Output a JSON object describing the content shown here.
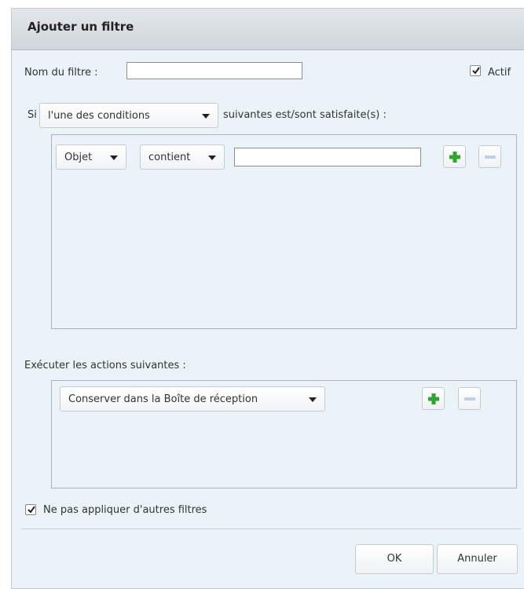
{
  "dialog": {
    "title": "Ajouter un filtre"
  },
  "filter_name": {
    "label": "Nom du filtre :",
    "value": ""
  },
  "active": {
    "label": "Actif",
    "checked": true
  },
  "conditions": {
    "prefix": "Si",
    "match_mode": "l'une des conditions",
    "suffix": "suivantes est/sont satisfaite(s) :",
    "rows": [
      {
        "field": "Objet",
        "operator": "contient",
        "value": ""
      }
    ]
  },
  "actions": {
    "label": "Exécuter les actions suivantes :",
    "rows": [
      {
        "action": "Conserver dans la Boîte de réception"
      }
    ]
  },
  "stop_processing": {
    "label": "Ne pas appliquer d'autres filtres",
    "checked": true
  },
  "buttons": {
    "ok": "OK",
    "cancel": "Annuler"
  },
  "colors": {
    "plus_icon": "#2fa52f",
    "minus_icon": "#b9d2ea",
    "dialog_bg": "#eaf3f8"
  },
  "icons": {
    "add": "plus-icon",
    "remove": "minus-icon",
    "dropdown": "caret-down-icon",
    "check": "check-icon"
  }
}
